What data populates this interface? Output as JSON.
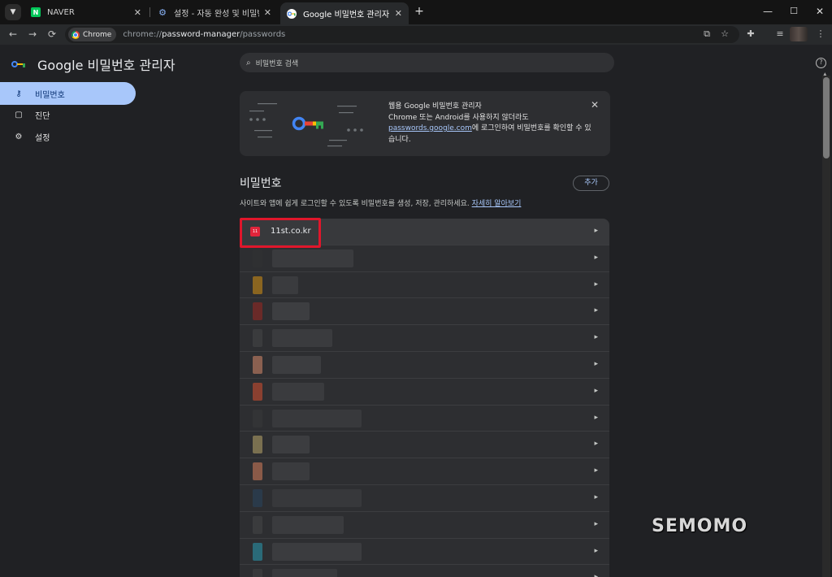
{
  "tabs": [
    {
      "title": "NAVER",
      "favicon": "N",
      "favicon_color": "#03c75a"
    },
    {
      "title": "설정 - 자동 완성 및 비밀번호",
      "favicon": "gear-icon",
      "favicon_color": "#8ab4f8"
    },
    {
      "title": "Google 비밀번호 관리자",
      "favicon": "key-icon",
      "favicon_color": "#ffffff"
    }
  ],
  "new_tab": "+",
  "window_controls": {
    "minimize": "—",
    "maximize": "☐",
    "close": "✕"
  },
  "omnibox": {
    "chip": "Chrome",
    "url_scheme": "chrome://",
    "url_host": "password-manager",
    "url_path": "/passwords"
  },
  "app": {
    "title": "Google 비밀번호 관리자"
  },
  "sidebar": {
    "items": [
      {
        "label": "비밀번호",
        "icon": "key-icon",
        "active": true
      },
      {
        "label": "진단",
        "icon": "checkup-icon",
        "active": false
      },
      {
        "label": "설정",
        "icon": "gear-icon",
        "active": false
      }
    ]
  },
  "search": {
    "placeholder": "비밀번호 검색"
  },
  "banner": {
    "heading": "웹용 Google 비밀번호 관리자",
    "line1": "Chrome 또는 Android를 사용하지 않더라도",
    "link": "passwords.google.com",
    "line2": "에 로그인하여 비밀번호를 확인할 수 있",
    "line3": "습니다."
  },
  "passwords_section": {
    "title": "비밀번호",
    "add_label": "추가",
    "description": "사이트와 앱에 쉽게 로그인할 수 있도록 비밀번호를 생성, 저장, 관리하세요.",
    "learn_more": "자세히 알아보기"
  },
  "password_list": [
    {
      "site": "11st.co.kr",
      "icon_text": "11",
      "icon_color": "#e1253b"
    },
    {
      "site": "",
      "icon_color": "#2f3032"
    },
    {
      "site": "",
      "icon_color": "#8a6520"
    },
    {
      "site": "",
      "icon_color": "#6a2a28"
    },
    {
      "site": "",
      "icon_color": "#3a3b3d"
    },
    {
      "site": "",
      "icon_color": "#8a6050"
    },
    {
      "site": "",
      "icon_color": "#8a4030"
    },
    {
      "site": "",
      "icon_color": "#333436"
    },
    {
      "site": "",
      "icon_color": "#7a7050"
    },
    {
      "site": "",
      "icon_color": "#8a5a48"
    },
    {
      "site": "",
      "icon_color": "#2a3a4a"
    },
    {
      "site": "",
      "icon_color": "#3a3b3d"
    },
    {
      "site": "",
      "icon_color": "#2a6a78"
    },
    {
      "site": "",
      "icon_color": "#38393b"
    }
  ],
  "watermark": "SEMOMO"
}
